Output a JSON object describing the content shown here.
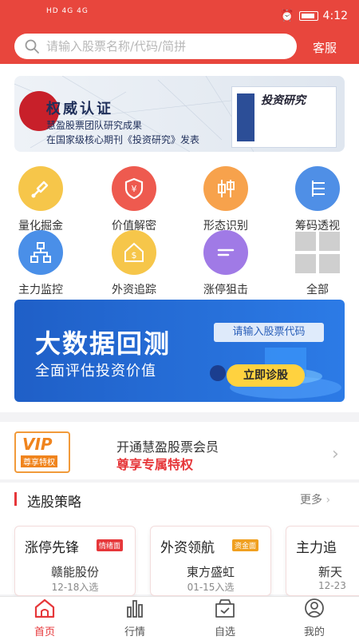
{
  "status_bar": {
    "left_text": "HD 4G 4G",
    "time": "4:12"
  },
  "search": {
    "placeholder": "请输入股票名称/代码/简拼",
    "service_label": "客服"
  },
  "banner1": {
    "title": "权威认证",
    "line1": "慧盈股票团队研究成果",
    "line2": "在国家级核心期刊《投资研究》发表",
    "journal_title": "投资研究"
  },
  "features": [
    {
      "label": "量化掘金",
      "icon": "shovel-icon",
      "color": "#f6c64a"
    },
    {
      "label": "价值解密",
      "icon": "shield-yen-icon",
      "color": "#ee5a4f"
    },
    {
      "label": "形态识别",
      "icon": "candlestick-icon",
      "color": "#f7a24c"
    },
    {
      "label": "筹码透视",
      "icon": "list-icon",
      "color": "#4f8fe6"
    },
    {
      "label": "主力监控",
      "icon": "org-chart-icon",
      "color": "#4a8fe8"
    },
    {
      "label": "外资追踪",
      "icon": "dollar-house-icon",
      "color": "#f6c64a"
    },
    {
      "label": "涨停狙击",
      "icon": "lines-icon",
      "color": "#a07ae6"
    },
    {
      "label": "全部",
      "icon": "grid-icon",
      "color": "#cfcfcf"
    }
  ],
  "banner2": {
    "title": "大数据回测",
    "subtitle": "全面评估投资价值",
    "input_placeholder": "请输入股票代码",
    "button": "立即诊股"
  },
  "vip": {
    "badge": "VIP",
    "badge_sub": "尊享特权",
    "line1": "开通慧盈股票会员",
    "line2": "尊享专属特权"
  },
  "strategy": {
    "title": "选股策略",
    "more": "更多",
    "cards": [
      {
        "title": "涨停先锋",
        "tag": "情绪面",
        "tag_color": "#e6373a",
        "stock": "赣能股份",
        "date": "12-18入选"
      },
      {
        "title": "外资领航",
        "tag": "资金面",
        "tag_color": "#f0a020",
        "stock": "東方盛虹",
        "date": "01-15入选"
      },
      {
        "title": "主力追",
        "tag": "",
        "tag_color": "",
        "stock": "新天",
        "date": "12-23"
      }
    ]
  },
  "nav": [
    {
      "label": "首页",
      "icon": "home-icon",
      "active": true
    },
    {
      "label": "行情",
      "icon": "bar-chart-icon",
      "active": false
    },
    {
      "label": "自选",
      "icon": "selected-box-icon",
      "active": false
    },
    {
      "label": "我的",
      "icon": "user-icon",
      "active": false
    }
  ],
  "colors": {
    "brand": "#e8463d",
    "accent_red": "#e6373a",
    "active_nav": "#e6373a",
    "inactive_nav": "#555555"
  }
}
